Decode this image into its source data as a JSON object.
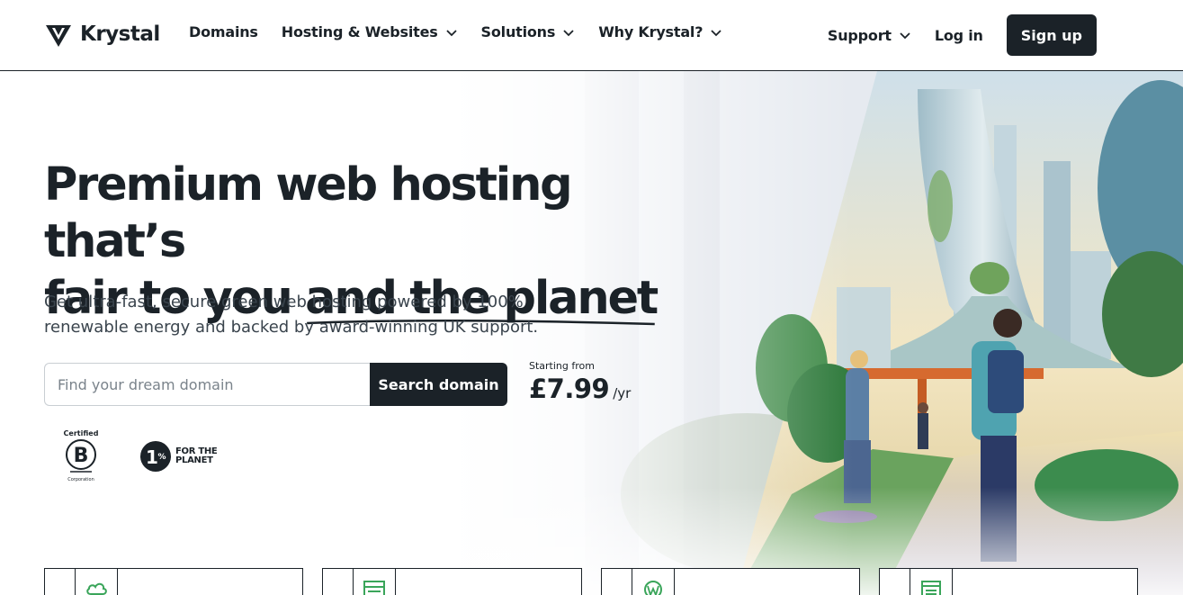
{
  "brand": {
    "name": "Krystal"
  },
  "nav": {
    "items": [
      {
        "label": "Domains",
        "has_dropdown": false
      },
      {
        "label": "Hosting & Websites",
        "has_dropdown": true
      },
      {
        "label": "Solutions",
        "has_dropdown": true
      },
      {
        "label": "Why Krystal?",
        "has_dropdown": true
      }
    ],
    "support_label": "Support",
    "login_label": "Log in",
    "signup_label": "Sign up"
  },
  "hero": {
    "headline_line1": "Premium web hosting that’s",
    "headline_line2_plain": "fair to you",
    "headline_line2_underlined": "and the planet",
    "subtext": "Get ultra-fast, secure green web hosting powered by 100% renewable energy and backed by award-winning UK support.",
    "search": {
      "placeholder": "Find your dream domain",
      "button_label": "Search domain"
    },
    "price": {
      "label": "Starting from",
      "value": "£7.99",
      "unit": "/yr"
    }
  },
  "badges": {
    "bcorp": {
      "top": "Certified",
      "bottom": "Corporation",
      "letter": "B"
    },
    "one_percent": {
      "number": "1",
      "symbol": "%",
      "line1": "FOR THE",
      "line2": "PLANET"
    }
  },
  "cards": [
    {
      "icon": "cloud-icon"
    },
    {
      "icon": "server-icon"
    },
    {
      "icon": "wordpress-icon"
    },
    {
      "icon": "reseller-icon"
    }
  ],
  "colors": {
    "ink": "#1b2228",
    "accent_green": "#3aa55a",
    "border_gray": "#c9ced3"
  }
}
